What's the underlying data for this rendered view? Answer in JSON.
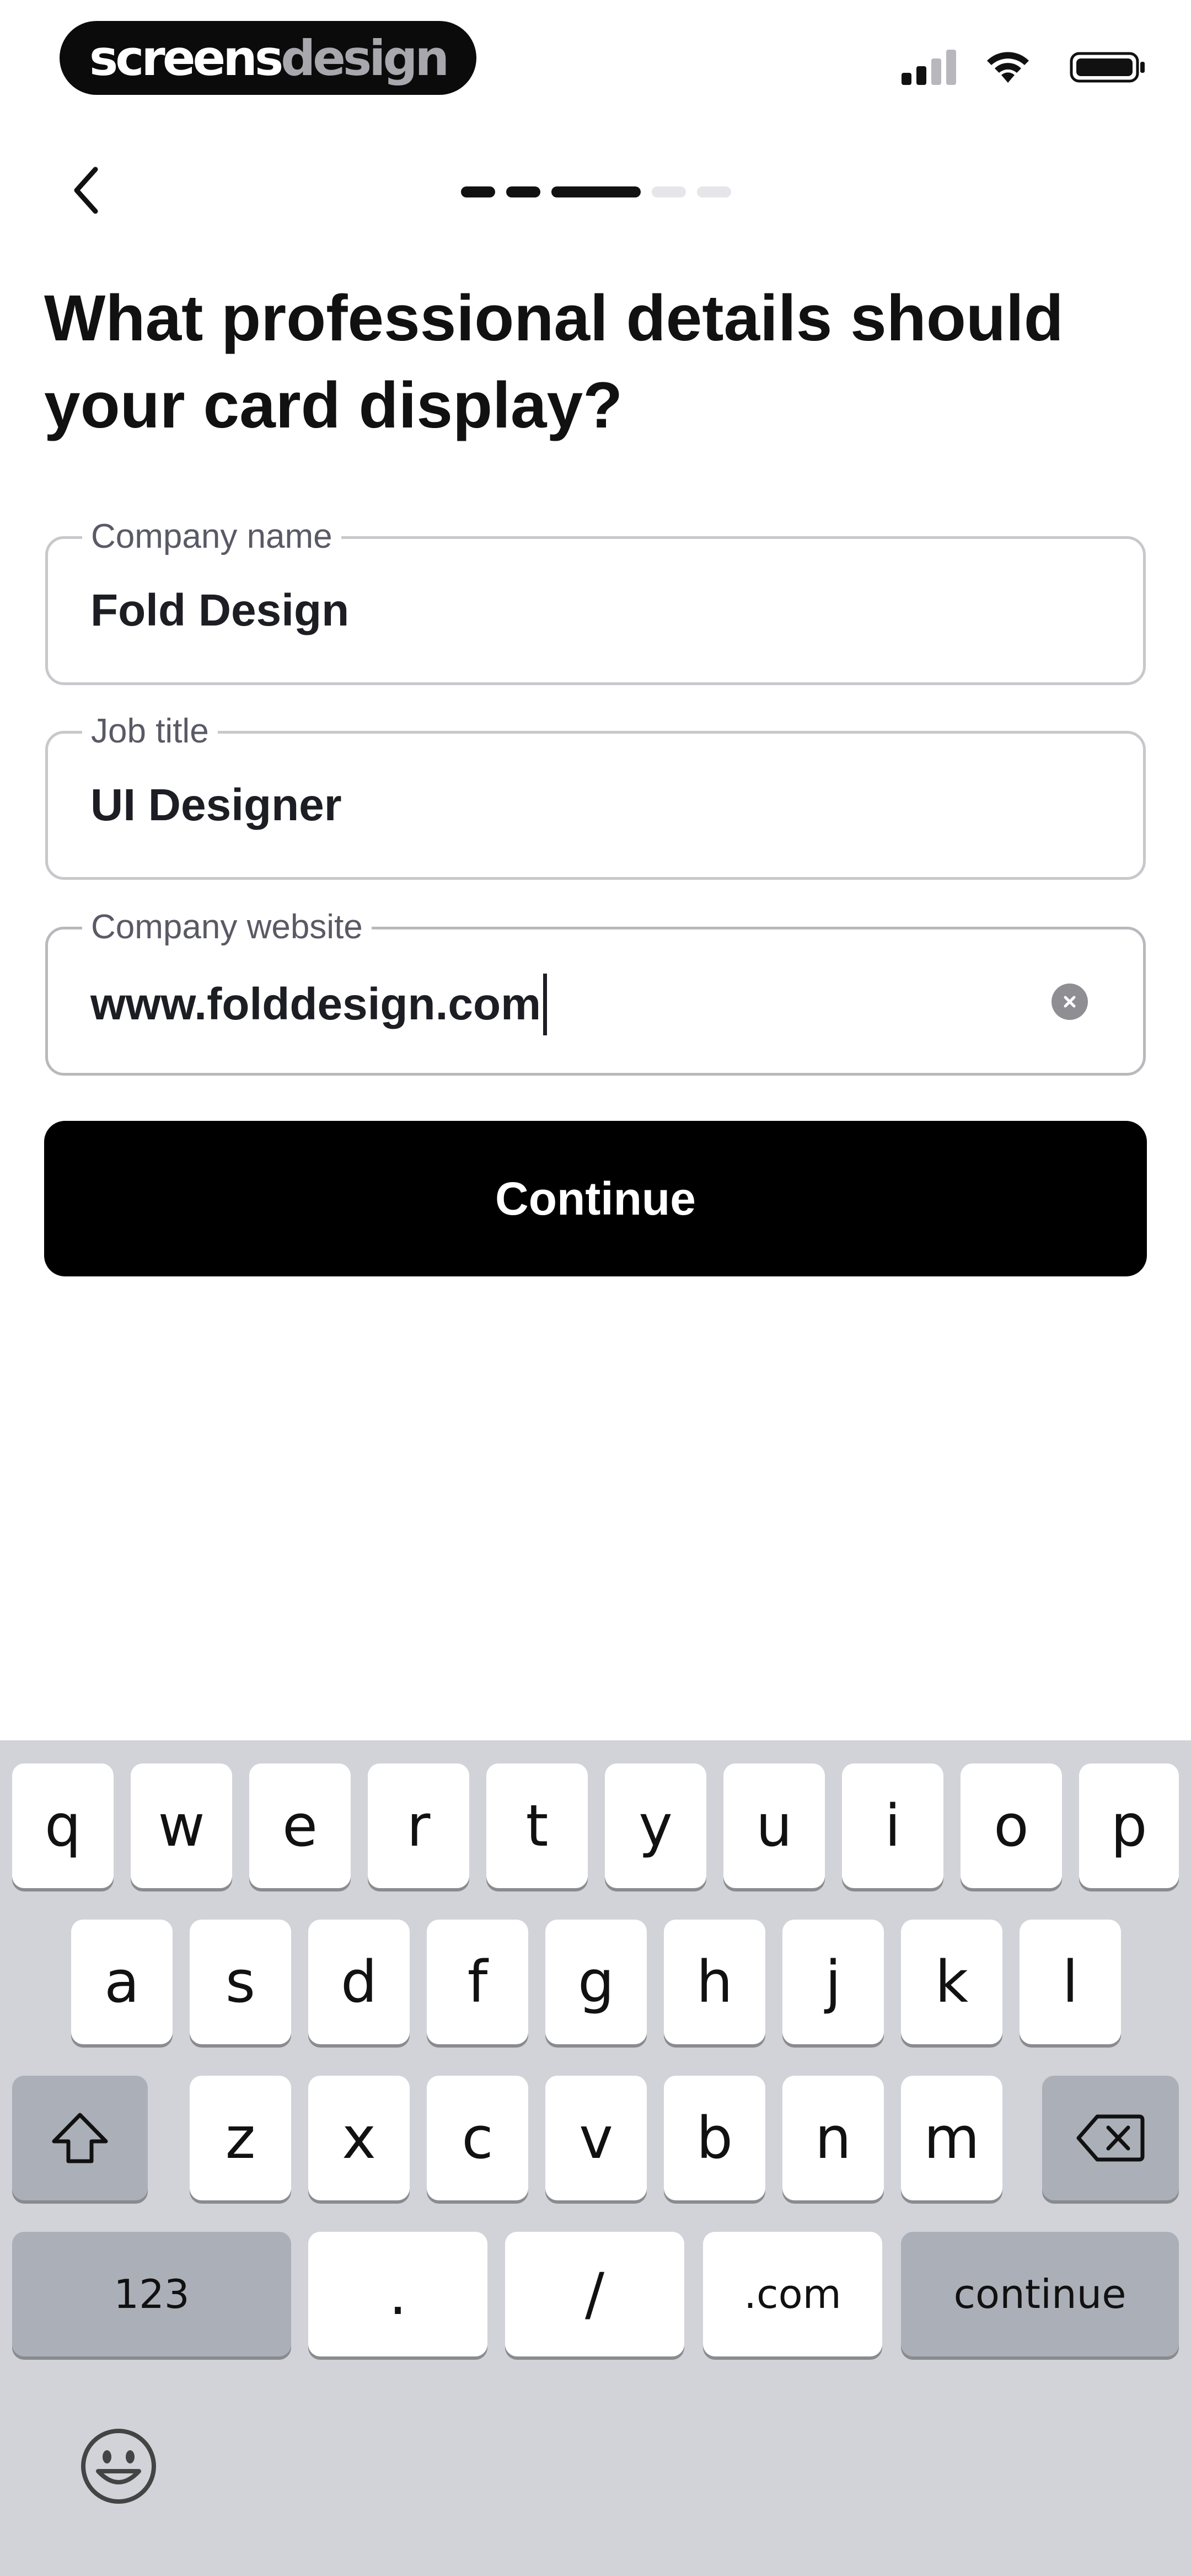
{
  "status_bar": {
    "logo_part1": "screens",
    "logo_part2": "design",
    "icons": [
      "cellular-signal-icon",
      "wifi-icon",
      "battery-icon"
    ]
  },
  "nav": {
    "back_icon": "chevron-left-icon",
    "progress": {
      "total_steps": 5,
      "current_step": 3
    }
  },
  "heading": "What professional details should your card display?",
  "fields": [
    {
      "label": "Company name",
      "value": "Fold Design"
    },
    {
      "label": "Job title",
      "value": "UI Designer"
    },
    {
      "label": "Company website",
      "value": "www.folddesign.com",
      "has_clear": true,
      "focused": true
    }
  ],
  "continue_label": "Continue",
  "keyboard": {
    "row1": [
      "q",
      "w",
      "e",
      "r",
      "t",
      "y",
      "u",
      "i",
      "o",
      "p"
    ],
    "row2": [
      "a",
      "s",
      "d",
      "f",
      "g",
      "h",
      "j",
      "k",
      "l"
    ],
    "row3": [
      "z",
      "x",
      "c",
      "v",
      "b",
      "n",
      "m"
    ],
    "numbers_label": "123",
    "dot_label": ".",
    "slash_label": "/",
    "dotcom_label": ".com",
    "return_label": "continue",
    "shift_icon": "shift-arrow-icon",
    "delete_icon": "backspace-icon",
    "emoji_icon": "emoji-smiley-icon"
  },
  "colors": {
    "primary_button": "#000000",
    "field_border": "#c8c8cc",
    "keyboard_bg": "#d1d3d9",
    "key_gray": "#abafb8"
  }
}
